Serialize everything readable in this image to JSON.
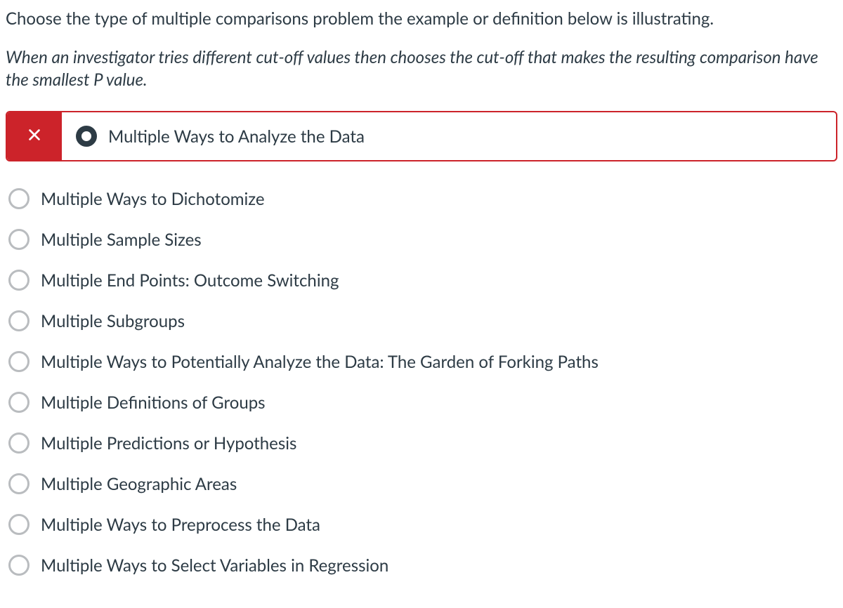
{
  "question": "Choose the type of multiple comparisons problem the example or definition below is illustrating.",
  "example": "When an investigator tries different cut-off values then chooses the cut-off that makes the resulting comparison have the smallest P value.",
  "selected": {
    "label": "Multiple Ways to Analyze the Data"
  },
  "options": [
    {
      "label": "Multiple Ways to Dichotomize"
    },
    {
      "label": "Multiple Sample Sizes"
    },
    {
      "label": "Multiple End Points:  Outcome Switching"
    },
    {
      "label": "Multiple Subgroups"
    },
    {
      "label": "Multiple Ways to Potentially Analyze the Data:  The Garden of Forking Paths"
    },
    {
      "label": "Multiple Definitions of Groups"
    },
    {
      "label": "Multiple Predictions or Hypothesis"
    },
    {
      "label": "Multiple Geographic Areas"
    },
    {
      "label": "Multiple Ways to Preprocess the Data"
    },
    {
      "label": "Multiple Ways to Select Variables in Regression"
    }
  ]
}
